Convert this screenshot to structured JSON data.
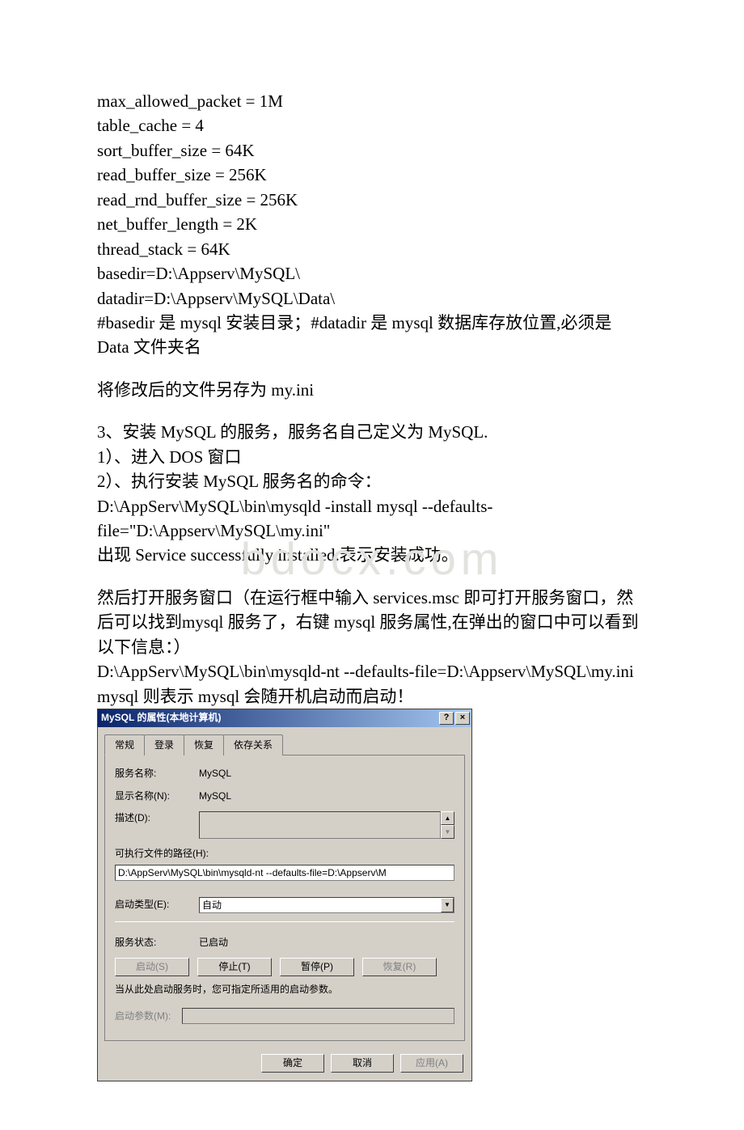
{
  "doc": {
    "cfg": [
      "max_allowed_packet = 1M",
      "table_cache = 4",
      "sort_buffer_size = 64K",
      "read_buffer_size = 256K",
      "read_rnd_buffer_size = 256K",
      "net_buffer_length = 2K",
      "thread_stack = 64K",
      "basedir=D:\\Appserv\\MySQL\\",
      "datadir=D:\\Appserv\\MySQL\\Data\\",
      "#basedir 是 mysql 安装目录；#datadir 是 mysql 数据库存放位置,必须是 Data 文件夹名"
    ],
    "p_save": "将修改后的文件另存为 my.ini",
    "p_s1": "3、安装 MySQL 的服务，服务名自己定义为 MySQL.",
    "p_s2": "1）、进入 DOS 窗口",
    "p_s3": "2）、执行安装 MySQL 服务名的命令：",
    "p_s4": "D:\\AppServ\\MySQL\\bin\\mysqld -install mysql --defaults-file=\"D:\\Appserv\\MySQL\\my.ini\"",
    "p_s5": "出现 Service successfully installed.表示安装成功。",
    "p_o1": "然后打开服务窗口（在运行框中输入 services.msc 即可打开服务窗口，然后可以找到mysql 服务了，右键 mysql 服务属性,在弹出的窗口中可以看到以下信息：）",
    "p_o2": "D:\\AppServ\\MySQL\\bin\\mysqld-nt --defaults-file=D:\\Appserv\\MySQL\\my.ini mysql  则表示 mysql 会随开机启动而启动！"
  },
  "watermark": "bdocx.com",
  "dialog": {
    "title": "MySQL 的属性(本地计算机)",
    "help_btn": "?",
    "close_btn": "×",
    "tabs": {
      "t0": "常规",
      "t1": "登录",
      "t2": "恢复",
      "t3": "依存关系"
    },
    "labels": {
      "service_name": "服务名称:",
      "display_name": "显示名称(N):",
      "description": "描述(D):",
      "exe_path": "可执行文件的路径(H):",
      "startup_type": "启动类型(E):",
      "service_status": "服务状态:",
      "start_params": "启动参数(M):"
    },
    "values": {
      "service_name": "MySQL",
      "display_name": "MySQL",
      "exe_path": "D:\\AppServ\\MySQL\\bin\\mysqld-nt --defaults-file=D:\\Appserv\\M",
      "startup_type": "自动",
      "service_status": "已启动",
      "start_params": ""
    },
    "buttons": {
      "start": "启动(S)",
      "stop": "停止(T)",
      "pause": "暂停(P)",
      "resume": "恢复(R)"
    },
    "note": "当从此处启动服务时，您可指定所适用的启动参数。",
    "footer": {
      "ok": "确定",
      "cancel": "取消",
      "apply": "应用(A)"
    }
  }
}
